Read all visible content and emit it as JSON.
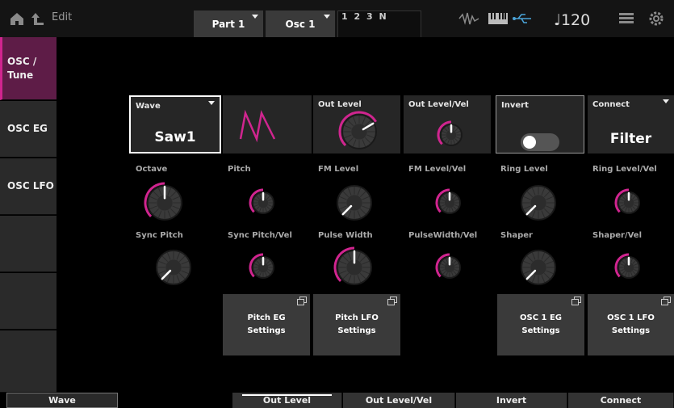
{
  "header": {
    "title": "Edit",
    "part_selector": "Part 1",
    "osc_selector": "Osc 1",
    "note_info": "1 2 3 N",
    "tempo": "♩120",
    "icons": [
      "home-icon",
      "back-arrow-icon",
      "audio-wave-icon",
      "keyboard-icon",
      "usb-icon",
      "grid-icon",
      "gear-icon"
    ]
  },
  "sidebar": {
    "items": [
      {
        "label": "OSC /\nTune",
        "active": true
      },
      {
        "label": "OSC EG",
        "active": false
      },
      {
        "label": "OSC LFO",
        "active": false
      },
      {
        "label": "",
        "active": false
      },
      {
        "label": "",
        "active": false
      },
      {
        "label": "",
        "active": false
      },
      {
        "label": "",
        "active": false
      }
    ]
  },
  "row1": {
    "wave": {
      "label": "Wave",
      "value": "Saw1"
    },
    "out_level": {
      "label": "Out Level",
      "level": 0.72
    },
    "out_level_vel": {
      "label": "Out Level/Vel",
      "level": 0.5
    },
    "invert": {
      "label": "Invert",
      "state": "off"
    },
    "connect": {
      "label": "Connect",
      "value": "Filter"
    }
  },
  "row2": {
    "octave": {
      "label": "Octave",
      "level": 0.5
    },
    "pitch": {
      "label": "Pitch",
      "level": 0.5
    },
    "fm_level": {
      "label": "FM Level",
      "level": 0.0
    },
    "fm_level_vel": {
      "label": "FM Level/Vel",
      "level": 0.5
    },
    "ring_level": {
      "label": "Ring Level",
      "level": 0.0
    },
    "ring_level_vel": {
      "label": "Ring Level/Vel",
      "level": 0.5
    }
  },
  "row3": {
    "sync_pitch": {
      "label": "Sync Pitch",
      "level": 0.0
    },
    "sync_pitch_vel": {
      "label": "Sync Pitch/Vel",
      "level": 0.5
    },
    "pulse_width": {
      "label": "Pulse Width",
      "level": 0.5
    },
    "pulse_width_vel": {
      "label": "PulseWidth/Vel",
      "level": 0.5
    },
    "shaper": {
      "label": "Shaper",
      "level": 0.0
    },
    "shaper_vel": {
      "label": "Shaper/Vel",
      "level": 0.5
    }
  },
  "buttons": {
    "pitch_eg": {
      "line1": "Pitch EG",
      "line2": "Settings"
    },
    "pitch_lfo": {
      "line1": "Pitch LFO",
      "line2": "Settings"
    },
    "osc1_eg": {
      "line1": "OSC 1 EG",
      "line2": "Settings"
    },
    "osc1_lfo": {
      "line1": "OSC 1 LFO",
      "line2": "Settings"
    }
  },
  "bottom_tabs": {
    "wave": "Wave",
    "out_level": "Out Level",
    "out_level_vel": "Out Level/Vel",
    "invert": "Invert",
    "connect": "Connect"
  },
  "colors": {
    "accent": "#d0258f",
    "active_tab_bg": "#5e1c47",
    "cell_bg": "#262626",
    "button_bg": "#3a3a3a"
  }
}
